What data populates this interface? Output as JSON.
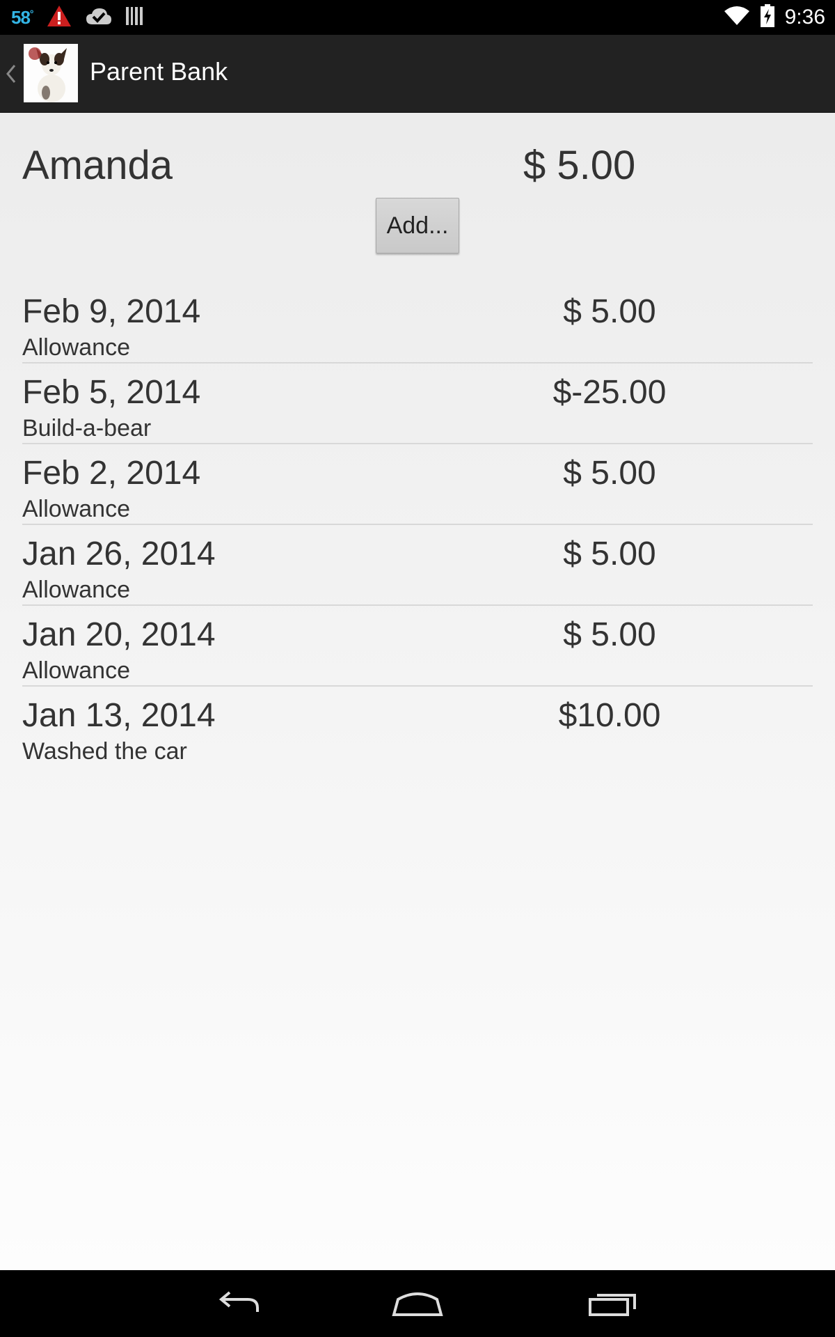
{
  "status_bar": {
    "temperature": "58",
    "temperature_unit": "°",
    "time": "9:36",
    "icons": [
      "alert-icon",
      "cloud-check-icon",
      "barcode-icon",
      "wifi-icon",
      "battery-charging-icon"
    ]
  },
  "action_bar": {
    "title": "Parent Bank",
    "app_icon": "dog-photo-icon"
  },
  "account": {
    "name": "Amanda",
    "balance": "$ 5.00",
    "add_label": "Add..."
  },
  "transactions": [
    {
      "date": "Feb 9, 2014",
      "amount": "$ 5.00",
      "description": "Allowance"
    },
    {
      "date": "Feb 5, 2014",
      "amount": "$-25.00",
      "description": "Build-a-bear"
    },
    {
      "date": "Feb 2, 2014",
      "amount": "$ 5.00",
      "description": "Allowance"
    },
    {
      "date": "Jan 26, 2014",
      "amount": "$ 5.00",
      "description": "Allowance"
    },
    {
      "date": "Jan 20, 2014",
      "amount": "$ 5.00",
      "description": "Allowance"
    },
    {
      "date": "Jan 13, 2014",
      "amount": "$10.00",
      "description": "Washed the car"
    }
  ],
  "nav_bar": {
    "buttons": [
      "back-icon",
      "home-icon",
      "recents-icon"
    ]
  },
  "colors": {
    "status_bar_bg": "#000000",
    "action_bar_bg": "#222222",
    "temperature_accent": "#33b5e5",
    "alert_red": "#cc1f1f",
    "text": "#333333"
  }
}
